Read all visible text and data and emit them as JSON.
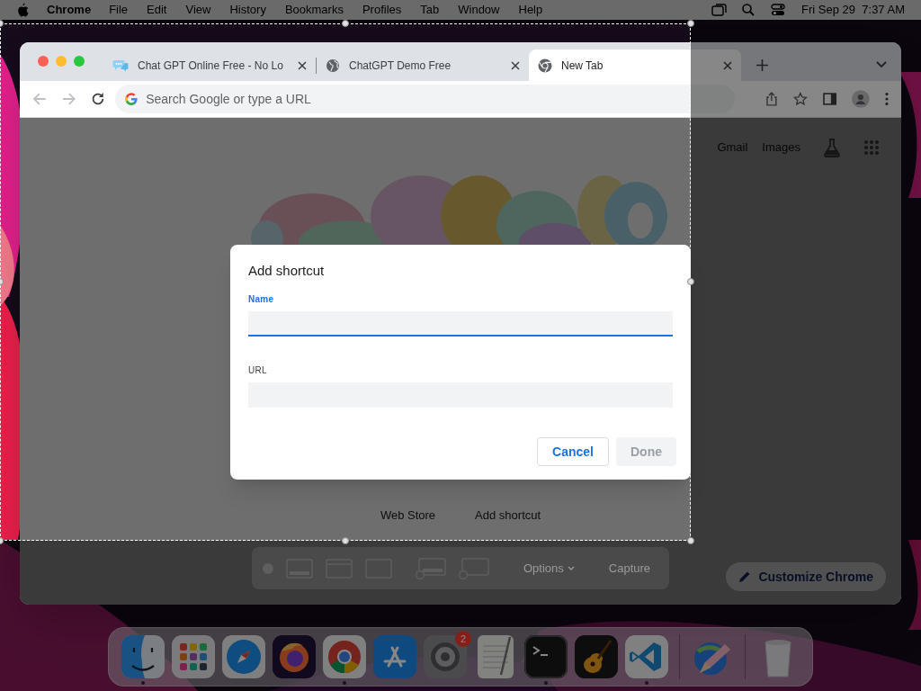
{
  "menu_bar": {
    "app": "Chrome",
    "menus": [
      "File",
      "Edit",
      "View",
      "History",
      "Bookmarks",
      "Profiles",
      "Tab",
      "Window",
      "Help"
    ],
    "clock": "Fri Sep 29  7:37 AM"
  },
  "browser": {
    "tabs": [
      {
        "title": "Chat GPT Online Free - No Lo",
        "kind": "chat",
        "selected": false
      },
      {
        "title": "ChatGPT Demo Free",
        "kind": "globe",
        "selected": false
      },
      {
        "title": "New Tab",
        "kind": "chrome",
        "selected": true
      }
    ],
    "omnibox": {
      "placeholder": "Search Google or type a URL"
    }
  },
  "page": {
    "links": [
      "Gmail",
      "Images"
    ],
    "shortcuts": [
      "Web Store",
      "Add shortcut"
    ],
    "customize_button": "Customize Chrome"
  },
  "dialog": {
    "title": "Add shortcut",
    "fields": [
      {
        "label": "Name",
        "focused": true
      },
      {
        "label": "URL",
        "focused": false
      }
    ],
    "buttons": [
      {
        "label": "Cancel",
        "disabled": false
      },
      {
        "label": "Done",
        "disabled": true
      }
    ]
  },
  "screenshot_toolbar": {
    "options": "Options",
    "capture": "Capture"
  },
  "dock": {
    "apps": [
      {
        "kind": "finder",
        "running": true
      },
      {
        "kind": "launchpad",
        "running": false
      },
      {
        "kind": "safari",
        "running": false
      },
      {
        "kind": "firefox",
        "running": false
      },
      {
        "kind": "chrome",
        "running": true
      },
      {
        "kind": "appstore",
        "running": false
      },
      {
        "kind": "settings",
        "running": false,
        "badge": "2"
      },
      {
        "kind": "textedit",
        "running": false
      },
      {
        "kind": "terminal",
        "running": true
      },
      {
        "kind": "garageband",
        "running": false
      },
      {
        "kind": "vscode",
        "running": true
      },
      {
        "kind": "divider"
      },
      {
        "kind": "pencil",
        "running": false
      },
      {
        "kind": "divider"
      },
      {
        "kind": "trash",
        "running": false
      }
    ]
  }
}
